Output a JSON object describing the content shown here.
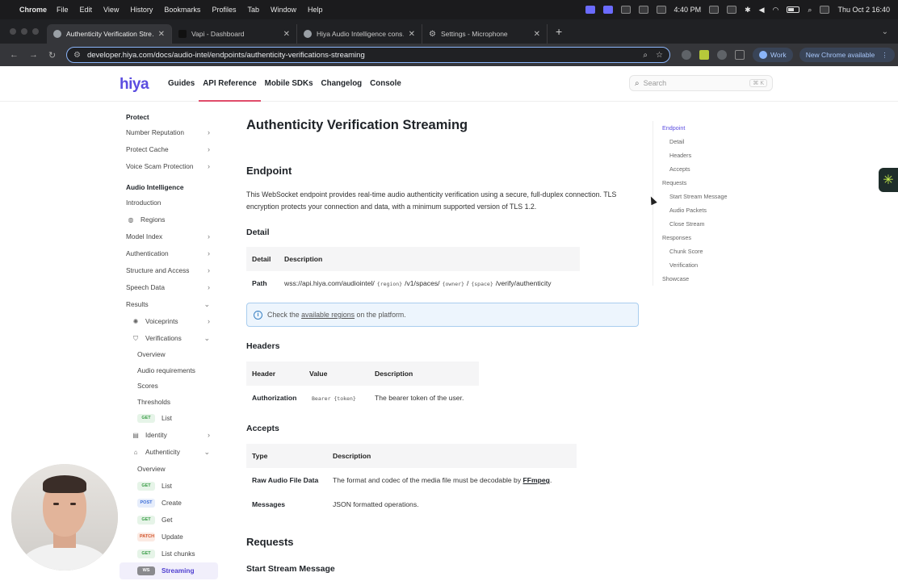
{
  "menubar": {
    "app_name": "Chrome",
    "menus": [
      "File",
      "Edit",
      "View",
      "History",
      "Bookmarks",
      "Profiles",
      "Tab",
      "Window",
      "Help"
    ],
    "time": "4:40 PM",
    "clock": "Thu Oct 2  16:40"
  },
  "tabs": [
    {
      "label": "Authenticity Verification Stre…",
      "active": true
    },
    {
      "label": "Vapi - Dashboard",
      "active": false
    },
    {
      "label": "Hiya Audio Intelligence cons…",
      "active": false
    },
    {
      "label": "Settings - Microphone",
      "active": false
    }
  ],
  "address_bar": {
    "url": "developer.hiya.com/docs/audio-intel/endpoints/authenticity-verifications-streaming",
    "work_label": "Work",
    "new_chrome_label": "New Chrome available"
  },
  "docnav": {
    "logo": "hiya",
    "links": [
      "Guides",
      "API Reference",
      "Mobile SDKs",
      "Changelog",
      "Console"
    ],
    "active_link": "API Reference",
    "search_placeholder": "Search",
    "search_shortcut": "⌘ K"
  },
  "sidebar": {
    "group_protect": "Protect",
    "protect_items": [
      "Number Reputation",
      "Protect Cache",
      "Voice Scam Protection"
    ],
    "group_audio": "Audio Intelligence",
    "intro": "Introduction",
    "regions": "Regions",
    "model_index": "Model Index",
    "authentication": "Authentication",
    "structure": "Structure and Access",
    "speech_data": "Speech Data",
    "results": "Results",
    "voiceprints": "Voiceprints",
    "verifications": "Verifications",
    "ver_overview": "Overview",
    "ver_audio_req": "Audio requirements",
    "ver_scores": "Scores",
    "ver_thresholds": "Thresholds",
    "ver_list_method": "GET",
    "ver_list": "List",
    "identity": "Identity",
    "authenticity": "Authenticity",
    "auth_overview": "Overview",
    "auth_endpoints": [
      {
        "method": "GET",
        "label": "List"
      },
      {
        "method": "POST",
        "label": "Create"
      },
      {
        "method": "GET",
        "label": "Get"
      },
      {
        "method": "PATCH",
        "label": "Update"
      },
      {
        "method": "GET",
        "label": "List chunks"
      },
      {
        "method": "WS",
        "label": "Streaming"
      }
    ]
  },
  "main": {
    "title": "Authenticity Verification Streaming",
    "endpoint_heading": "Endpoint",
    "endpoint_text": "This WebSocket endpoint provides real-time audio authenticity verification using a secure, full-duplex connection. TLS encryption protects your connection and data, with a minimum supported version of TLS 1.2.",
    "detail_heading": "Detail",
    "detail_table": {
      "headers": [
        "Detail",
        "Description"
      ],
      "path_label": "Path",
      "path_parts": [
        "wss://api.hiya.com/audiointel/",
        "{region}",
        "/v1/spaces/",
        "{owner}",
        "/",
        "{space}",
        "/verify/authenticity"
      ]
    },
    "callout": {
      "prefix": "Check the",
      "link": "available regions",
      "suffix": "on the platform."
    },
    "headers_heading": "Headers",
    "headers_table": {
      "headers": [
        "Header",
        "Value",
        "Description"
      ],
      "row": {
        "header": "Authorization",
        "value": "Bearer {token}",
        "description": "The bearer token of the user."
      }
    },
    "accepts_heading": "Accepts",
    "accepts_table": {
      "headers": [
        "Type",
        "Description"
      ],
      "rows": [
        {
          "type": "Raw Audio File Data",
          "desc_prefix": "The format and codec of the media file must be decodable by",
          "link": "FFmpeg",
          "desc_suffix": "."
        },
        {
          "type": "Messages",
          "desc_prefix": "JSON formatted operations.",
          "link": "",
          "desc_suffix": ""
        }
      ]
    },
    "requests_heading": "Requests",
    "start_stream_heading": "Start Stream Message"
  },
  "toc": {
    "endpoint": "Endpoint",
    "detail": "Detail",
    "headers": "Headers",
    "accepts": "Accepts",
    "requests": "Requests",
    "start_stream": "Start Stream Message",
    "audio_packets": "Audio Packets",
    "close_stream": "Close Stream",
    "responses": "Responses",
    "chunk_score": "Chunk Score",
    "verification": "Verification",
    "showcase": "Showcase"
  }
}
